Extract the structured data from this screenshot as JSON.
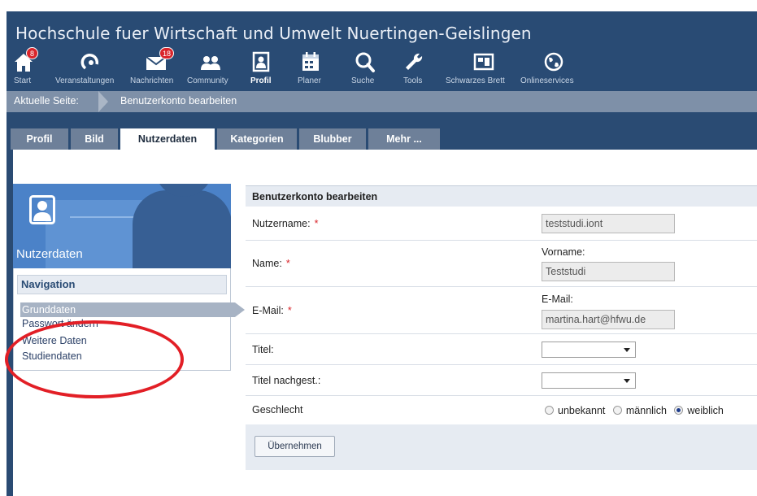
{
  "site": {
    "title": "Hochschule fuer Wirtschaft und Umwelt Nuertingen-Geislingen"
  },
  "nav": {
    "items": [
      {
        "label": "Start",
        "icon": "home-icon",
        "badge": "8"
      },
      {
        "label": "Veranstaltungen",
        "icon": "events-icon"
      },
      {
        "label": "Nachrichten",
        "icon": "mail-icon",
        "badge": "18"
      },
      {
        "label": "Community",
        "icon": "community-icon"
      },
      {
        "label": "Profil",
        "icon": "profile-icon",
        "active": true
      },
      {
        "label": "Planer",
        "icon": "calendar-icon"
      },
      {
        "label": "Suche",
        "icon": "search-icon"
      },
      {
        "label": "Tools",
        "icon": "wrench-icon"
      },
      {
        "label": "Schwarzes Brett",
        "icon": "board-icon"
      },
      {
        "label": "Onlineservices",
        "icon": "globe-icon"
      }
    ]
  },
  "breadcrumb": {
    "label": "Aktuelle Seite:",
    "current": "Benutzerkonto bearbeiten"
  },
  "tabs": [
    {
      "label": "Profil"
    },
    {
      "label": "Bild"
    },
    {
      "label": "Nutzerdaten",
      "active": true
    },
    {
      "label": "Kategorien"
    },
    {
      "label": "Blubber"
    },
    {
      "label": "Mehr ..."
    }
  ],
  "sidebar": {
    "title": "Nutzerdaten",
    "nav_heading": "Navigation",
    "links": [
      {
        "label": "Grunddaten",
        "active": true
      },
      {
        "label": "Passwort ändern"
      },
      {
        "label": "Weitere Daten"
      },
      {
        "label": "Studiendaten"
      }
    ]
  },
  "form": {
    "heading": "Benutzerkonto bearbeiten",
    "username": {
      "label": "Nutzername:",
      "required": "*",
      "value": "teststudi.iont"
    },
    "name": {
      "label": "Name:",
      "required": "*",
      "sublabel": "Vorname:",
      "value": "Teststudi"
    },
    "email": {
      "label": "E-Mail:",
      "required": "*",
      "sublabel": "E-Mail:",
      "value": "martina.hart@hfwu.de"
    },
    "title": {
      "label": "Titel:",
      "value": ""
    },
    "title_after": {
      "label": "Titel nachgest.:",
      "value": ""
    },
    "gender": {
      "label": "Geschlecht",
      "options": [
        "unbekannt",
        "männlich",
        "weiblich"
      ],
      "selected": "weiblich"
    },
    "submit_label": "Übernehmen"
  },
  "colors": {
    "header": "#294b74",
    "breadcrumb": "#7e90a8",
    "tab_inactive": "#6e8099",
    "required": "#d9252b",
    "annotation": "#e21f26"
  }
}
